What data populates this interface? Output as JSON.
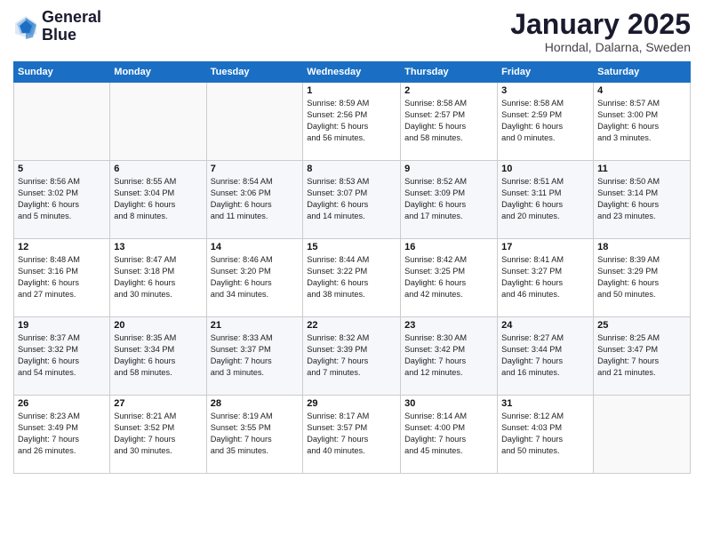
{
  "header": {
    "logo_line1": "General",
    "logo_line2": "Blue",
    "month_title": "January 2025",
    "subtitle": "Horndal, Dalarna, Sweden"
  },
  "days_of_week": [
    "Sunday",
    "Monday",
    "Tuesday",
    "Wednesday",
    "Thursday",
    "Friday",
    "Saturday"
  ],
  "weeks": [
    [
      {
        "day": "",
        "info": ""
      },
      {
        "day": "",
        "info": ""
      },
      {
        "day": "",
        "info": ""
      },
      {
        "day": "1",
        "info": "Sunrise: 8:59 AM\nSunset: 2:56 PM\nDaylight: 5 hours\nand 56 minutes."
      },
      {
        "day": "2",
        "info": "Sunrise: 8:58 AM\nSunset: 2:57 PM\nDaylight: 5 hours\nand 58 minutes."
      },
      {
        "day": "3",
        "info": "Sunrise: 8:58 AM\nSunset: 2:59 PM\nDaylight: 6 hours\nand 0 minutes."
      },
      {
        "day": "4",
        "info": "Sunrise: 8:57 AM\nSunset: 3:00 PM\nDaylight: 6 hours\nand 3 minutes."
      }
    ],
    [
      {
        "day": "5",
        "info": "Sunrise: 8:56 AM\nSunset: 3:02 PM\nDaylight: 6 hours\nand 5 minutes."
      },
      {
        "day": "6",
        "info": "Sunrise: 8:55 AM\nSunset: 3:04 PM\nDaylight: 6 hours\nand 8 minutes."
      },
      {
        "day": "7",
        "info": "Sunrise: 8:54 AM\nSunset: 3:06 PM\nDaylight: 6 hours\nand 11 minutes."
      },
      {
        "day": "8",
        "info": "Sunrise: 8:53 AM\nSunset: 3:07 PM\nDaylight: 6 hours\nand 14 minutes."
      },
      {
        "day": "9",
        "info": "Sunrise: 8:52 AM\nSunset: 3:09 PM\nDaylight: 6 hours\nand 17 minutes."
      },
      {
        "day": "10",
        "info": "Sunrise: 8:51 AM\nSunset: 3:11 PM\nDaylight: 6 hours\nand 20 minutes."
      },
      {
        "day": "11",
        "info": "Sunrise: 8:50 AM\nSunset: 3:14 PM\nDaylight: 6 hours\nand 23 minutes."
      }
    ],
    [
      {
        "day": "12",
        "info": "Sunrise: 8:48 AM\nSunset: 3:16 PM\nDaylight: 6 hours\nand 27 minutes."
      },
      {
        "day": "13",
        "info": "Sunrise: 8:47 AM\nSunset: 3:18 PM\nDaylight: 6 hours\nand 30 minutes."
      },
      {
        "day": "14",
        "info": "Sunrise: 8:46 AM\nSunset: 3:20 PM\nDaylight: 6 hours\nand 34 minutes."
      },
      {
        "day": "15",
        "info": "Sunrise: 8:44 AM\nSunset: 3:22 PM\nDaylight: 6 hours\nand 38 minutes."
      },
      {
        "day": "16",
        "info": "Sunrise: 8:42 AM\nSunset: 3:25 PM\nDaylight: 6 hours\nand 42 minutes."
      },
      {
        "day": "17",
        "info": "Sunrise: 8:41 AM\nSunset: 3:27 PM\nDaylight: 6 hours\nand 46 minutes."
      },
      {
        "day": "18",
        "info": "Sunrise: 8:39 AM\nSunset: 3:29 PM\nDaylight: 6 hours\nand 50 minutes."
      }
    ],
    [
      {
        "day": "19",
        "info": "Sunrise: 8:37 AM\nSunset: 3:32 PM\nDaylight: 6 hours\nand 54 minutes."
      },
      {
        "day": "20",
        "info": "Sunrise: 8:35 AM\nSunset: 3:34 PM\nDaylight: 6 hours\nand 58 minutes."
      },
      {
        "day": "21",
        "info": "Sunrise: 8:33 AM\nSunset: 3:37 PM\nDaylight: 7 hours\nand 3 minutes."
      },
      {
        "day": "22",
        "info": "Sunrise: 8:32 AM\nSunset: 3:39 PM\nDaylight: 7 hours\nand 7 minutes."
      },
      {
        "day": "23",
        "info": "Sunrise: 8:30 AM\nSunset: 3:42 PM\nDaylight: 7 hours\nand 12 minutes."
      },
      {
        "day": "24",
        "info": "Sunrise: 8:27 AM\nSunset: 3:44 PM\nDaylight: 7 hours\nand 16 minutes."
      },
      {
        "day": "25",
        "info": "Sunrise: 8:25 AM\nSunset: 3:47 PM\nDaylight: 7 hours\nand 21 minutes."
      }
    ],
    [
      {
        "day": "26",
        "info": "Sunrise: 8:23 AM\nSunset: 3:49 PM\nDaylight: 7 hours\nand 26 minutes."
      },
      {
        "day": "27",
        "info": "Sunrise: 8:21 AM\nSunset: 3:52 PM\nDaylight: 7 hours\nand 30 minutes."
      },
      {
        "day": "28",
        "info": "Sunrise: 8:19 AM\nSunset: 3:55 PM\nDaylight: 7 hours\nand 35 minutes."
      },
      {
        "day": "29",
        "info": "Sunrise: 8:17 AM\nSunset: 3:57 PM\nDaylight: 7 hours\nand 40 minutes."
      },
      {
        "day": "30",
        "info": "Sunrise: 8:14 AM\nSunset: 4:00 PM\nDaylight: 7 hours\nand 45 minutes."
      },
      {
        "day": "31",
        "info": "Sunrise: 8:12 AM\nSunset: 4:03 PM\nDaylight: 7 hours\nand 50 minutes."
      },
      {
        "day": "",
        "info": ""
      }
    ]
  ]
}
